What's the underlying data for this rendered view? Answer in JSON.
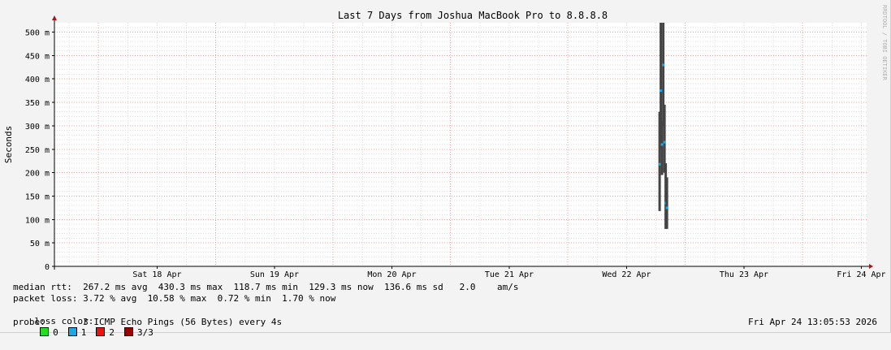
{
  "chart_data": {
    "type": "line",
    "title": "Last 7 Days from Joshua MacBook Pro to 8.8.8.8",
    "ylabel": "Seconds",
    "watermark": "RRDTOOL / TOBI OETIKER",
    "ylim": [
      0,
      520
    ],
    "y_ticks": [
      {
        "value": 0,
        "label": "0"
      },
      {
        "value": 50,
        "label": "50 m"
      },
      {
        "value": 100,
        "label": "100 m"
      },
      {
        "value": 150,
        "label": "150 m"
      },
      {
        "value": 200,
        "label": "200 m"
      },
      {
        "value": 250,
        "label": "250 m"
      },
      {
        "value": 300,
        "label": "300 m"
      },
      {
        "value": 350,
        "label": "350 m"
      },
      {
        "value": 400,
        "label": "400 m"
      },
      {
        "value": 450,
        "label": "450 m"
      },
      {
        "value": 500,
        "label": "500 m"
      }
    ],
    "xlim": [
      "2026-04-17T15:00",
      "2026-04-24T13:05"
    ],
    "x_ticks": [
      {
        "value": "2026-04-18T12:00",
        "label": "Sat 18 Apr"
      },
      {
        "value": "2026-04-19T12:00",
        "label": "Sun 19 Apr"
      },
      {
        "value": "2026-04-20T12:00",
        "label": "Mon 20 Apr"
      },
      {
        "value": "2026-04-21T12:00",
        "label": "Tue 21 Apr"
      },
      {
        "value": "2026-04-22T12:00",
        "label": "Wed 22 Apr"
      },
      {
        "value": "2026-04-23T12:00",
        "label": "Thu 23 Apr"
      },
      {
        "value": "2026-04-24T12:00",
        "label": "Fri 24 Apr"
      }
    ],
    "grid": true,
    "series": [
      {
        "color": "#444444",
        "points": [
          {
            "x": "2026-04-22T18:45",
            "min": 118,
            "max": 330,
            "median": 218
          },
          {
            "x": "2026-04-22T19:00",
            "min": 250,
            "max": 520,
            "median": 375
          },
          {
            "x": "2026-04-22T19:15",
            "min": 195,
            "max": 310,
            "median": 260
          },
          {
            "x": "2026-04-22T19:30",
            "min": 300,
            "max": 520,
            "median": 430
          },
          {
            "x": "2026-04-22T19:45",
            "min": 200,
            "max": 345,
            "median": 265
          },
          {
            "x": "2026-04-22T20:00",
            "min": 80,
            "max": 220,
            "median": 135
          },
          {
            "x": "2026-04-22T20:15",
            "min": 80,
            "max": 190,
            "median": 125
          }
        ]
      }
    ]
  },
  "stats": {
    "median_rtt": "median rtt:  267.2 ms avg  430.3 ms max  118.7 ms min  129.3 ms now  136.6 ms sd   2.0    am/s",
    "packet_loss": "packet loss: 3.72 % avg  10.58 % max  0.72 % min  1.70 % now",
    "loss_color_label": "loss color:",
    "loss_legend": [
      {
        "label": "0",
        "color": "#22dd22"
      },
      {
        "label": "1",
        "color": "#1ea7e6"
      },
      {
        "label": "2",
        "color": "#ee1111"
      },
      {
        "label": "3/3",
        "color": "#990000"
      }
    ],
    "probe": "probe:       3 ICMP Echo Pings (56 Bytes) every 4s",
    "timestamp": "Fri Apr 24 13:05:53 2026"
  }
}
